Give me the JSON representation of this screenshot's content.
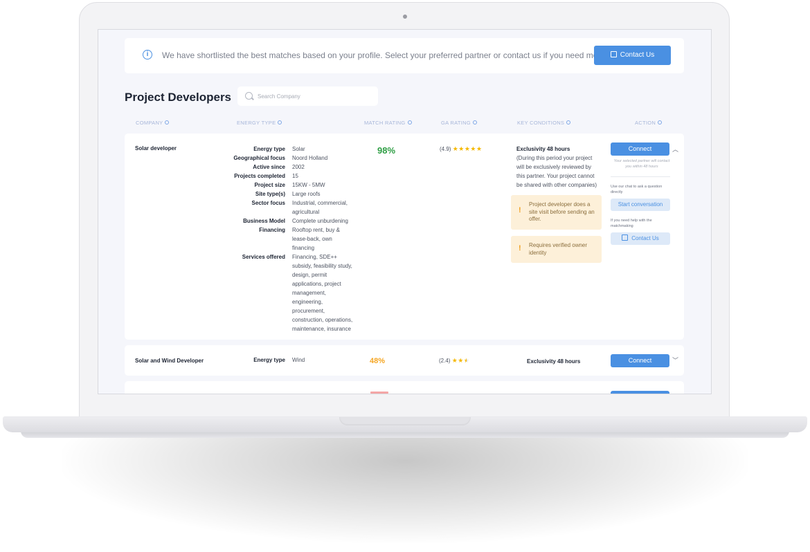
{
  "banner": {
    "text": "We have shortlisted the best matches based on your profile. Select your preferred partner or contact us if you need more help.",
    "contact_label": "Contact Us"
  },
  "page": {
    "title": "Project Developers"
  },
  "search": {
    "placeholder": "Search Company"
  },
  "columns": [
    "COMPANY",
    "ENERGY TYPE",
    "MATCH RATING",
    "GA RATING",
    "KEY CONDITIONS",
    "ACTION"
  ],
  "developers": [
    {
      "company": "Solar developer",
      "details": [
        {
          "label": "Energy type",
          "value": "Solar"
        },
        {
          "label": "Geographical focus",
          "value": "Noord Holland"
        },
        {
          "label": "Active since",
          "value": "2002"
        },
        {
          "label": "Projects completed",
          "value": "15"
        },
        {
          "label": "Project size",
          "value": "15KW - 5MW"
        },
        {
          "label": "Site type(s)",
          "value": "Large roofs"
        },
        {
          "label": "Sector focus",
          "value": "Industrial, commercial, agricultural"
        },
        {
          "label": "Business Model",
          "value": "Complete unburdening"
        },
        {
          "label": "Financing",
          "value": "Rooftop rent, buy & lease-back, own financing"
        },
        {
          "label": "Services offered",
          "value": "Financing, SDE++ subsidy, feasibility study, design, permit applications, project management, engineering, procurement, construction, operations, maintenance, insurance"
        }
      ],
      "match": "98%",
      "match_color": "#2e9e44",
      "ga_rating": "(4.9)",
      "stars_filled": 5,
      "condition_title": "Exclusivity 48 hours",
      "condition_text": "(During this period your project will be exclusively reviewed by this partner. Your project cannot be shared with other companies)",
      "warnings": [
        "Project developer does a site visit before sending an offer.",
        "Requires verified owner identity"
      ],
      "connect_label": "Connect",
      "connect_note": "Your selected partner will contact you within 48 hours",
      "chat_note": "Use our chat to ask a question directly",
      "start_conversation_label": "Start conversation",
      "help_note": "If you need help with the matchmaking",
      "contact_label": "Contact Us"
    },
    {
      "company": "Solar and Wind Developer",
      "details": [
        {
          "label": "Energy type",
          "value": "Wind"
        }
      ],
      "match": "48%",
      "match_color": "#f5a623",
      "ga_rating": "(2.4)",
      "stars_filled": 2.5,
      "condition_title": "Exclusivity 48 hours",
      "connect_label": "Connect"
    }
  ]
}
